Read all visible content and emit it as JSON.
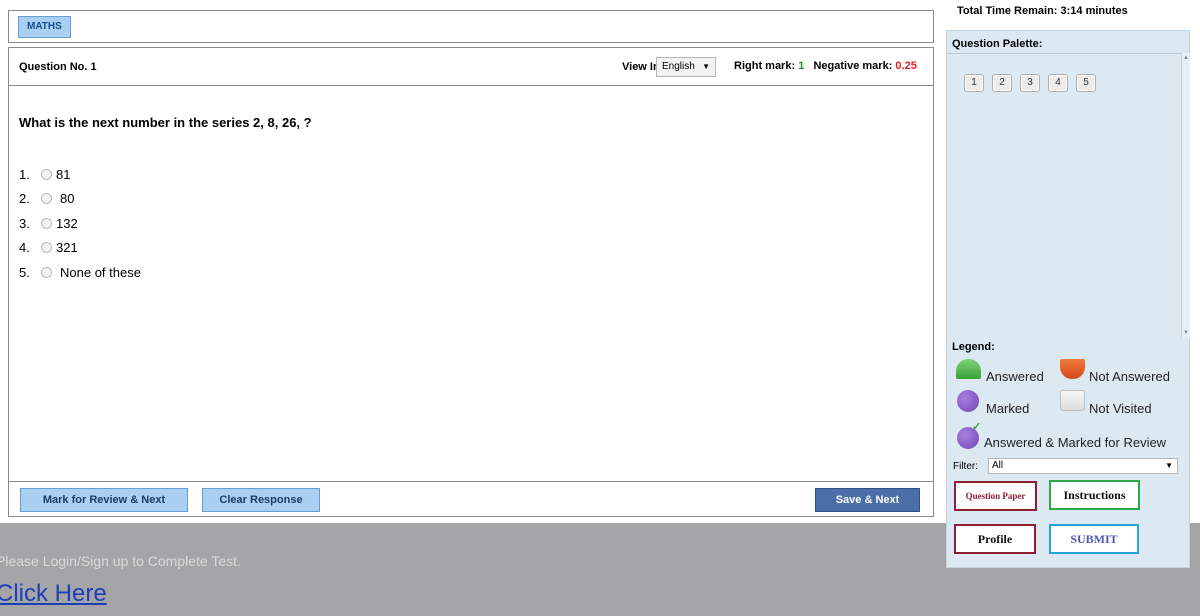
{
  "subject": {
    "tab_label": "MATHS"
  },
  "question": {
    "number_label": "Question No. 1",
    "view_in_label": "View In:",
    "language": "English",
    "right_mark_label": "Right mark:",
    "right_mark_value": "1",
    "negative_mark_label": "Negative mark:",
    "negative_mark_value": "0.25",
    "text": "What is the next number in the series 2, 8, 26, ?",
    "options": [
      {
        "num": "1.",
        "text": "81"
      },
      {
        "num": "2.",
        "text": "80"
      },
      {
        "num": "3.",
        "text": "132"
      },
      {
        "num": "4.",
        "text": "321"
      },
      {
        "num": "5.",
        "text": "None of these"
      }
    ]
  },
  "footer": {
    "review_label": "Mark for Review & Next",
    "clear_label": "Clear Response",
    "save_label": "Save & Next"
  },
  "login": {
    "message": "Please Login/Sign up to Complete Test.",
    "link": "Click Here"
  },
  "timer": {
    "text": "Total Time Remain: 3:14 minutes"
  },
  "palette": {
    "title": "Question Palette:",
    "buttons": [
      "1",
      "2",
      "3",
      "4",
      "5"
    ]
  },
  "legend": {
    "title": "Legend:",
    "answered": "Answered",
    "not_answered": "Not Answered",
    "marked": "Marked",
    "not_visited": "Not Visited",
    "answered_marked": "Answered & Marked for Review"
  },
  "filter": {
    "label": "Filter:",
    "value": "All"
  },
  "actions": {
    "question_paper": "Question Paper",
    "instructions": "Instructions",
    "profile": "Profile",
    "submit": "SUBMIT"
  },
  "colors": {
    "tab_blue": "#a9cff3",
    "save_blue": "#4b6ea8",
    "panel_bg": "#dce9f3",
    "right_mark_green": "#2a8a2a",
    "negative_mark_red": "#e02020",
    "login_strip_gray": "#a5a5a7",
    "link_blue": "#1a3fb8"
  }
}
